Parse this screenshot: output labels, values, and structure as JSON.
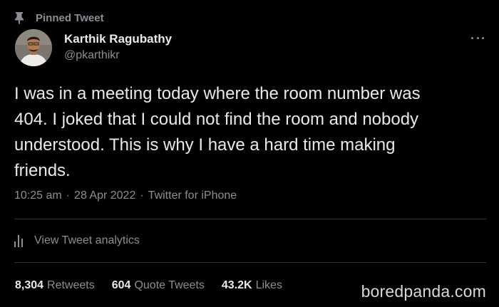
{
  "pinned": {
    "label": "Pinned Tweet",
    "icon": "pin-icon"
  },
  "author": {
    "name": "Karthik Ragubathy",
    "handle": "@pkarthikr"
  },
  "more_icon": "more-horizontal-icon",
  "tweet": {
    "text": "I was in a meeting today where the room number was\n404. I joked that I could not find the room and nobody\nunderstood. This is why I have a hard time making\nfriends."
  },
  "meta": {
    "time": "10:25 am",
    "sep1": "·",
    "date": "28 Apr 2022",
    "sep2": "·",
    "source": "Twitter for iPhone"
  },
  "analytics": {
    "label": "View Tweet analytics",
    "icon": "analytics-bars-icon"
  },
  "stats": {
    "retweets_count": "8,304",
    "retweets_label": "Retweets",
    "quotes_count": "604",
    "quotes_label": "Quote Tweets",
    "likes_count": "43.2K",
    "likes_label": "Likes"
  },
  "watermark": "boredpanda.com",
  "colors": {
    "background": "#000000",
    "primary_text": "#e7e9ea",
    "secondary_text": "#8b8f93",
    "divider": "#2f3336"
  }
}
